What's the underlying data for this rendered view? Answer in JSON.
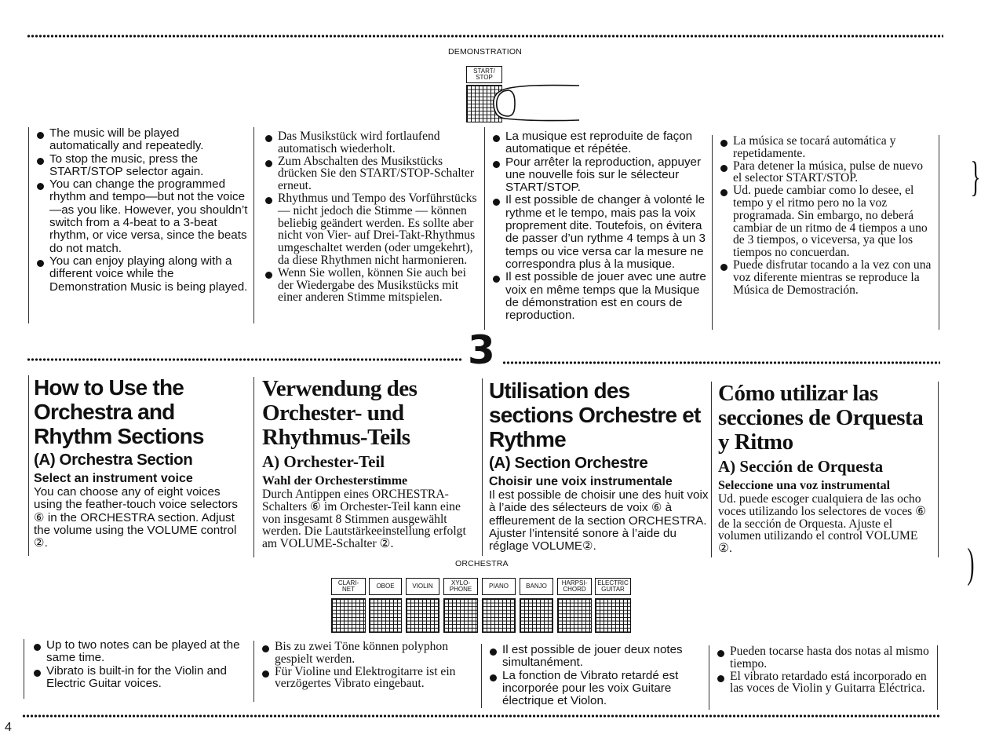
{
  "page_number": "4",
  "demonstration": {
    "caption": "DEMONSTRATION",
    "button_label": "START/ STOP"
  },
  "section_marker": "3",
  "demo_notes": {
    "en": [
      "The music will be played automatically and repeatedly.",
      "To stop the music, press the START/STOP selector again.",
      "You can change the programmed rhythm and tempo—but not the voice—as you like. However, you shouldn’t switch from a 4-beat to a 3-beat rhythm, or vice versa, since the beats do not match.",
      "You can enjoy playing along with a different voice while the Demonstration Music is being played."
    ],
    "de": [
      "Das Musikstück wird fortlaufend automatisch wiederholt.",
      "Zum Abschalten des Musikstücks drücken Sie den START/STOP-Schalter erneut.",
      "Rhythmus und Tempo des Vorführstücks — nicht jedoch die Stimme — können beliebig geändert werden. Es sollte aber nicht von Vier- auf Drei-Takt-Rhythmus umgeschaltet werden (oder umgekehrt), da diese Rhythmen nicht harmonieren.",
      "Wenn Sie wollen, können Sie auch bei der Wiedergabe des Musikstücks mit einer anderen Stimme mitspielen."
    ],
    "fr": [
      "La musique est reproduite de façon automatique et répétée.",
      "Pour arrêter la reproduction, appuyer une nouvelle fois sur le sélecteur START/STOP.",
      "Il est possible de changer à volonté le rythme et le tempo, mais pas la voix proprement dite. Toutefois, on évitera de passer d’un rythme 4 temps à un 3 temps ou vice versa car la mesure ne correspondra plus à la musique.",
      "Il est possible de jouer avec une autre voix en même temps que la Musique de démonstration est en cours de reproduction."
    ],
    "es": [
      "La música se tocará automática y repetidamente.",
      "Para detener la música, pulse de nuevo el selector START/STOP.",
      "Ud. puede cambiar como lo desee, el tempo y el ritmo pero no la voz programada. Sin embargo, no deberá cambiar de un ritmo de 4 tiempos a uno de 3 tiempos, o viceversa, ya que los tiempos no concuerdan.",
      "Puede disfrutar tocando a la vez con una voz diferente mientras se reproduce la Música de Demostración."
    ]
  },
  "orchestra_section": {
    "en": {
      "title": "How to Use the Orchestra and Rhythm Sections",
      "subtitle": "(A) Orchestra Section",
      "heading": "Select an instrument voice",
      "body": "You can choose any of eight voices using the feather-touch voice selectors ⑥ in the ORCHESTRA section. Adjust the volume using the VOLUME control ②."
    },
    "de": {
      "title": "Verwendung des Orchester- und Rhythmus-Teils",
      "subtitle": "A) Orchester-Teil",
      "heading": "Wahl der Orchesterstimme",
      "body": "Durch Antippen eines ORCHESTRA-Schalters ⑥ im Orchester-Teil kann eine von insgesamt 8 Stimmen ausgewählt werden. Die Lautstärkeeinstellung erfolgt am VOLUME-Schalter ②."
    },
    "fr": {
      "title": "Utilisation des sections Orchestre et Rythme",
      "subtitle": "(A) Section Orchestre",
      "heading": "Choisir une voix instrumentale",
      "body": "Il est possible de choisir une des huit voix à l’aide des sélecteurs de voix ⑥ à effleurement de la section ORCHESTRA. Ajuster l’intensité sonore à l’aide du réglage VOLUME②."
    },
    "es": {
      "title": "Cómo utilizar las secciones de Orquesta y Ritmo",
      "subtitle": "A) Sección de Orquesta",
      "heading": "Seleccione una voz instrumental",
      "body": "Ud. puede escoger cualquiera de las ocho voces utilizando los selectores de voces ⑥ de la sección de Orquesta. Ajuste el volumen utilizando el control VOLUME ②."
    }
  },
  "orchestra_panel": {
    "caption": "ORCHESTRA",
    "voices": [
      "CLARI- NET",
      "OBOE",
      "VIOLIN",
      "XYLO- PHONE",
      "PIANO",
      "BANJO",
      "HARPSI- CHORD",
      "ELECTRIC GUITAR"
    ]
  },
  "orchestra_notes": {
    "en": [
      "Up to two notes can be played at the same time.",
      "Vibrato is built-in for the Violin and Electric Guitar voices."
    ],
    "de": [
      "Bis zu zwei Töne können polyphon gespielt werden.",
      "Für Violine und Elektrogitarre ist ein verzögertes Vibrato eingebaut."
    ],
    "fr": [
      "Il est possible de jouer deux notes simultanément.",
      "La fonction de Vibrato retardé est incorporée pour les voix Guitare électrique et Violon."
    ],
    "es": [
      "Pueden tocarse hasta dos notas al mismo tiempo.",
      "El vibrato retardado está incorporado en las voces de Violin y Guitarra Eléctrica."
    ]
  }
}
